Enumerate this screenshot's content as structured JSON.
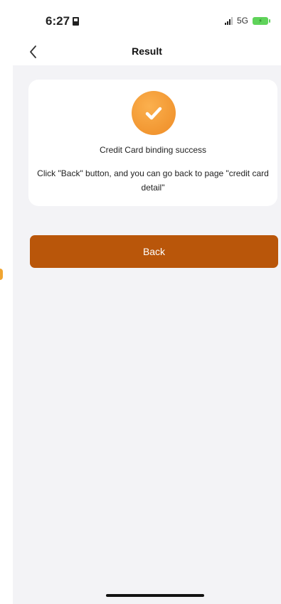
{
  "status_bar": {
    "time": "6:27",
    "network": "5G",
    "sim_icon": "sim-card-icon",
    "signal_icon": "signal-icon",
    "battery_icon": "battery-charging-icon"
  },
  "nav": {
    "back_icon": "chevron-left-icon",
    "title": "Result"
  },
  "result": {
    "icon": "check-circle-icon",
    "title": "Credit Card binding success",
    "description": "Click \"Back\" button, and you can go back to page \"credit card detail\""
  },
  "actions": {
    "back_label": "Back"
  },
  "colors": {
    "accent": "#b9560a",
    "success_icon": "#f39a35",
    "background": "#f3f3f6"
  }
}
